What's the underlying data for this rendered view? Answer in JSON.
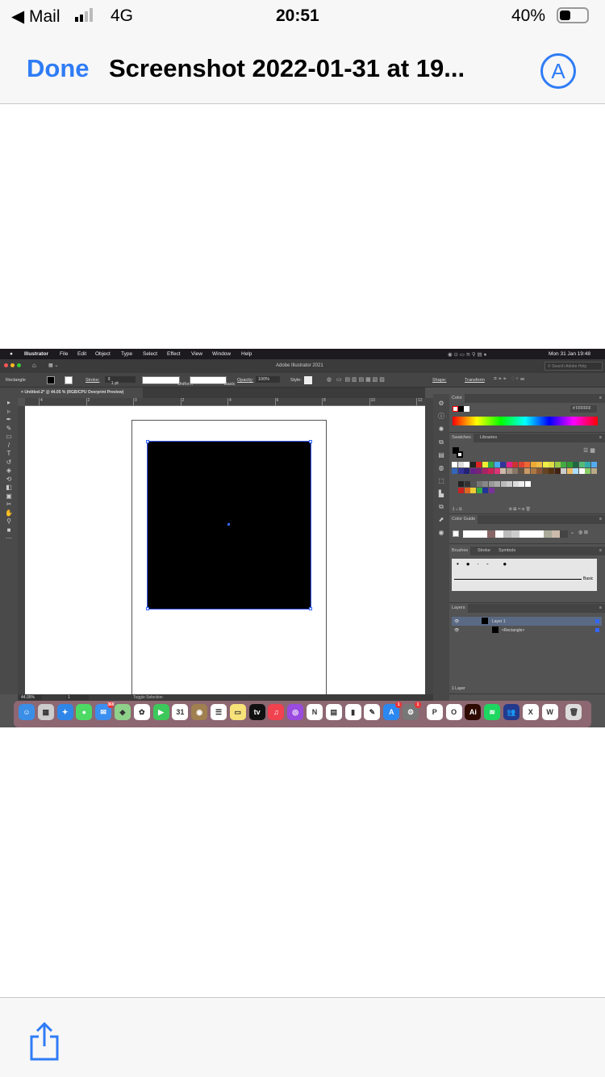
{
  "status_bar": {
    "back_app": "Mail",
    "carrier": "4G",
    "time": "20:51",
    "battery": "40%"
  },
  "nav": {
    "done": "Done",
    "title": "Screenshot 2022-01-31 at 19..."
  },
  "illustrator": {
    "menu": [
      "Illustrator",
      "File",
      "Edit",
      "Object",
      "Type",
      "Select",
      "Effect",
      "View",
      "Window",
      "Help"
    ],
    "clock": "Mon 31 Jan  19:48",
    "window_title": "Adobe Illustrator 2021",
    "search_placeholder": "Search Adobe Help",
    "control": {
      "tool": "Rectangle",
      "stroke_label": "Stroke:",
      "stroke_value": "1 pt",
      "profile": "Uniform",
      "brush": "Basic",
      "opacity_label": "Opacity:",
      "opacity_value": "100%",
      "style_label": "Style:",
      "shape_label": "Shape:",
      "transform_label": "Transform"
    },
    "doc_tab": "Untitled-2* @ 44.05 % (RGB/CPU Overprint Preview)",
    "ruler": [
      "4",
      "2",
      "0",
      "2",
      "4",
      "6",
      "8",
      "10",
      "12"
    ],
    "statusbar": {
      "zoom": "44.05%",
      "artboard": "1",
      "tool_hint": "Toggle Selection"
    },
    "color_panel": {
      "title": "Color",
      "hex": "FFFFFF"
    },
    "swatches_panel": {
      "tabs": [
        "Swatches",
        "Libraries"
      ],
      "row1": [
        "#ffffff",
        "#ddd",
        "#fff",
        "#222",
        "#d22",
        "#ee3",
        "#3a4",
        "#4ae",
        "#339",
        "#d28",
        "#c33",
        "#d43",
        "#e63",
        "#ea3",
        "#eb4",
        "#ee4",
        "#dd4",
        "#9c4",
        "#4a4",
        "#393",
        "#264",
        "#5b7",
        "#3aa",
        "#5ae"
      ],
      "row2": [
        "#36b",
        "#339",
        "#227",
        "#628",
        "#727",
        "#a26",
        "#c25",
        "#d37",
        "#cba",
        "#a98",
        "#876",
        "#654",
        "#c96",
        "#a74",
        "#853",
        "#642",
        "#531",
        "#421",
        "#ccc",
        "#eb6",
        "#adf",
        "#fff",
        "#8c6",
        "#ba8"
      ],
      "row3": [
        "#222",
        "#333",
        "#555",
        "#777",
        "#888",
        "#999",
        "#aaa",
        "#bbb",
        "#ccc",
        "#ddd",
        "#eee",
        "#fff"
      ],
      "row4": [
        "#c22",
        "#d62",
        "#ec3",
        "#3a4",
        "#239",
        "#739"
      ]
    },
    "color_guide": {
      "title": "Color Guide",
      "colors": [
        "#fff",
        "#fff",
        "#fff",
        "#866",
        "#fff",
        "#bbb",
        "#ccc",
        "#fff",
        "#fff",
        "#fff",
        "#aa9",
        "#cba",
        "#444"
      ]
    },
    "brushes_panel": {
      "tabs": [
        "Brushes",
        "Stroke",
        "Symbols"
      ],
      "brush_name": "Basic"
    },
    "layers_panel": {
      "title": "Layers",
      "layers": [
        "Layer 1",
        "<Rectangle>"
      ],
      "count": "1 Layer"
    },
    "dock": [
      {
        "name": "finder",
        "color": "#3a8ee6",
        "glyph": "☺"
      },
      {
        "name": "launchpad",
        "color": "#ccc",
        "glyph": "▦"
      },
      {
        "name": "safari",
        "color": "#2f86e8",
        "glyph": "✦"
      },
      {
        "name": "messages",
        "color": "#4cd964",
        "glyph": "●"
      },
      {
        "name": "mail",
        "color": "#3b8ff0",
        "glyph": "✉",
        "badge": "360"
      },
      {
        "name": "maps",
        "color": "#8fd18a",
        "glyph": "◆"
      },
      {
        "name": "photos",
        "color": "#fff",
        "glyph": "✿"
      },
      {
        "name": "facetime",
        "color": "#3cc85a",
        "glyph": "▶"
      },
      {
        "name": "calendar",
        "color": "#fff",
        "glyph": "31"
      },
      {
        "name": "contacts",
        "color": "#a0804f",
        "glyph": "◉"
      },
      {
        "name": "reminders",
        "color": "#fff",
        "glyph": "☰"
      },
      {
        "name": "notes",
        "color": "#f7e27a",
        "glyph": "▭"
      },
      {
        "name": "tv",
        "color": "#111",
        "glyph": "tv"
      },
      {
        "name": "music",
        "color": "#f0424f",
        "glyph": "♫"
      },
      {
        "name": "podcasts",
        "color": "#9a4be0",
        "glyph": "◎"
      },
      {
        "name": "news",
        "color": "#fff",
        "glyph": "N"
      },
      {
        "name": "keynote",
        "color": "#fff",
        "glyph": "▤"
      },
      {
        "name": "numbers",
        "color": "#fff",
        "glyph": "▮"
      },
      {
        "name": "pages",
        "color": "#fff",
        "glyph": "✎"
      },
      {
        "name": "app-store",
        "color": "#2b88f0",
        "glyph": "A",
        "badge": "1"
      },
      {
        "name": "system-preferences",
        "color": "#777",
        "glyph": "⚙",
        "badge": "1"
      },
      {
        "name": "powerpoint",
        "color": "#fff",
        "glyph": "P"
      },
      {
        "name": "outlook",
        "color": "#fff",
        "glyph": "O"
      },
      {
        "name": "illustrator",
        "color": "#2e0a00",
        "glyph": "Ai"
      },
      {
        "name": "spotify",
        "color": "#1ed760",
        "glyph": "≋"
      },
      {
        "name": "teams",
        "color": "#243a8c",
        "glyph": "👥"
      },
      {
        "name": "excel",
        "color": "#fff",
        "glyph": "X"
      },
      {
        "name": "word",
        "color": "#fff",
        "glyph": "W"
      },
      {
        "name": "trash",
        "color": "#ddd",
        "glyph": "🗑"
      }
    ]
  }
}
